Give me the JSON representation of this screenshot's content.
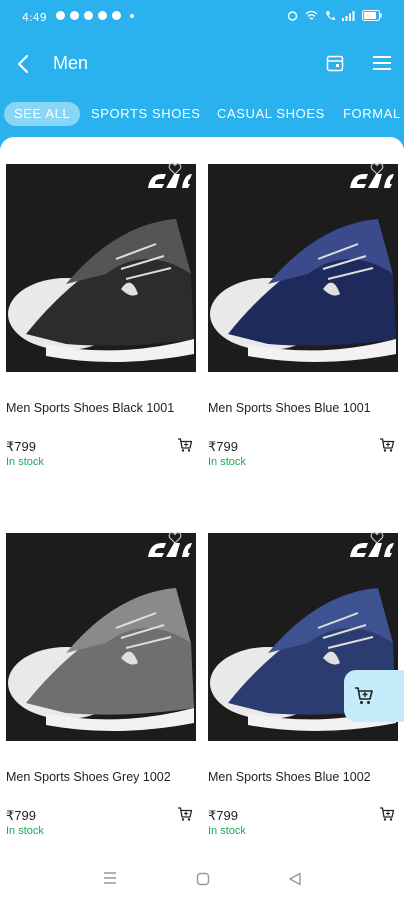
{
  "status_bar": {
    "time": "4:49"
  },
  "app_bar": {
    "title": "Men"
  },
  "tabs": [
    {
      "label": "SEE ALL",
      "active": true
    },
    {
      "label": "SPORTS SHOES",
      "active": false
    },
    {
      "label": "CASUAL SHOES",
      "active": false
    },
    {
      "label": "FORMAL S",
      "active": false
    }
  ],
  "products": [
    {
      "name": "Men Sports Shoes Black 1001",
      "price": "₹799",
      "stock": "In stock",
      "shoe_color": "#2c2c2c",
      "accent": "#555555"
    },
    {
      "name": "Men Sports Shoes Blue 1001",
      "price": "₹799",
      "stock": "In stock",
      "shoe_color": "#1f2a5c",
      "accent": "#3a4a8a"
    },
    {
      "name": "Men Sports Shoes Grey 1002",
      "price": "₹799",
      "stock": "In stock",
      "shoe_color": "#6f6f6f",
      "accent": "#8a8a8a"
    },
    {
      "name": "Men Sports Shoes Blue 1002",
      "price": "₹799",
      "stock": "In stock",
      "shoe_color": "#2a3c70",
      "accent": "#3d5290"
    }
  ],
  "colors": {
    "primary": "#29b2ee",
    "in_stock": "#1aaa55",
    "fab_bg": "#c6ebfb"
  }
}
